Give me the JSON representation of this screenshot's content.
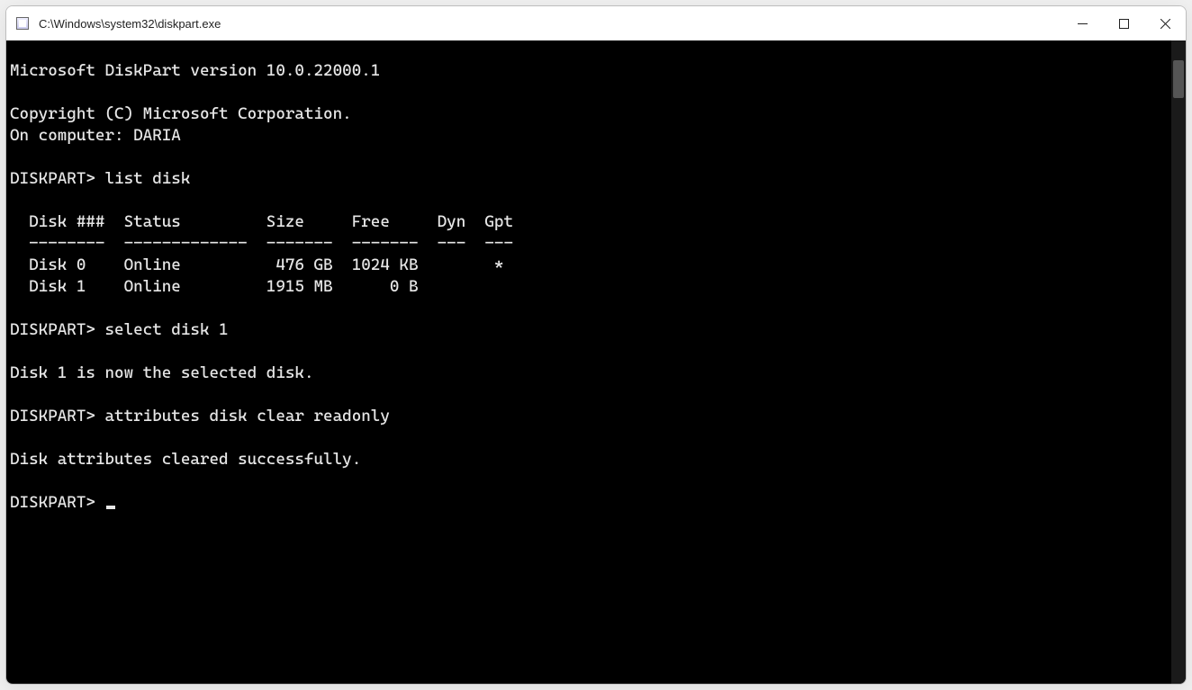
{
  "window": {
    "title": "C:\\Windows\\system32\\diskpart.exe"
  },
  "terminal": {
    "header_line": "Microsoft DiskPart version 10.0.22000.1",
    "copyright_line": "Copyright (C) Microsoft Corporation.",
    "computer_line": "On computer: DARIA",
    "prompt": "DISKPART>",
    "cmd_list": "list disk",
    "cmd_select": "select disk 1",
    "cmd_attr": "attributes disk clear readonly",
    "msg_selected": "Disk 1 is now the selected disk.",
    "msg_cleared": "Disk attributes cleared successfully.",
    "table": {
      "header_row": "  Disk ###  Status         Size     Free     Dyn  Gpt",
      "divider_row": "  --------  -------------  -------  -------  ---  ---",
      "rows": [
        "  Disk 0    Online          476 GB  1024 KB        *",
        "  Disk 1    Online         1915 MB      0 B"
      ]
    }
  }
}
